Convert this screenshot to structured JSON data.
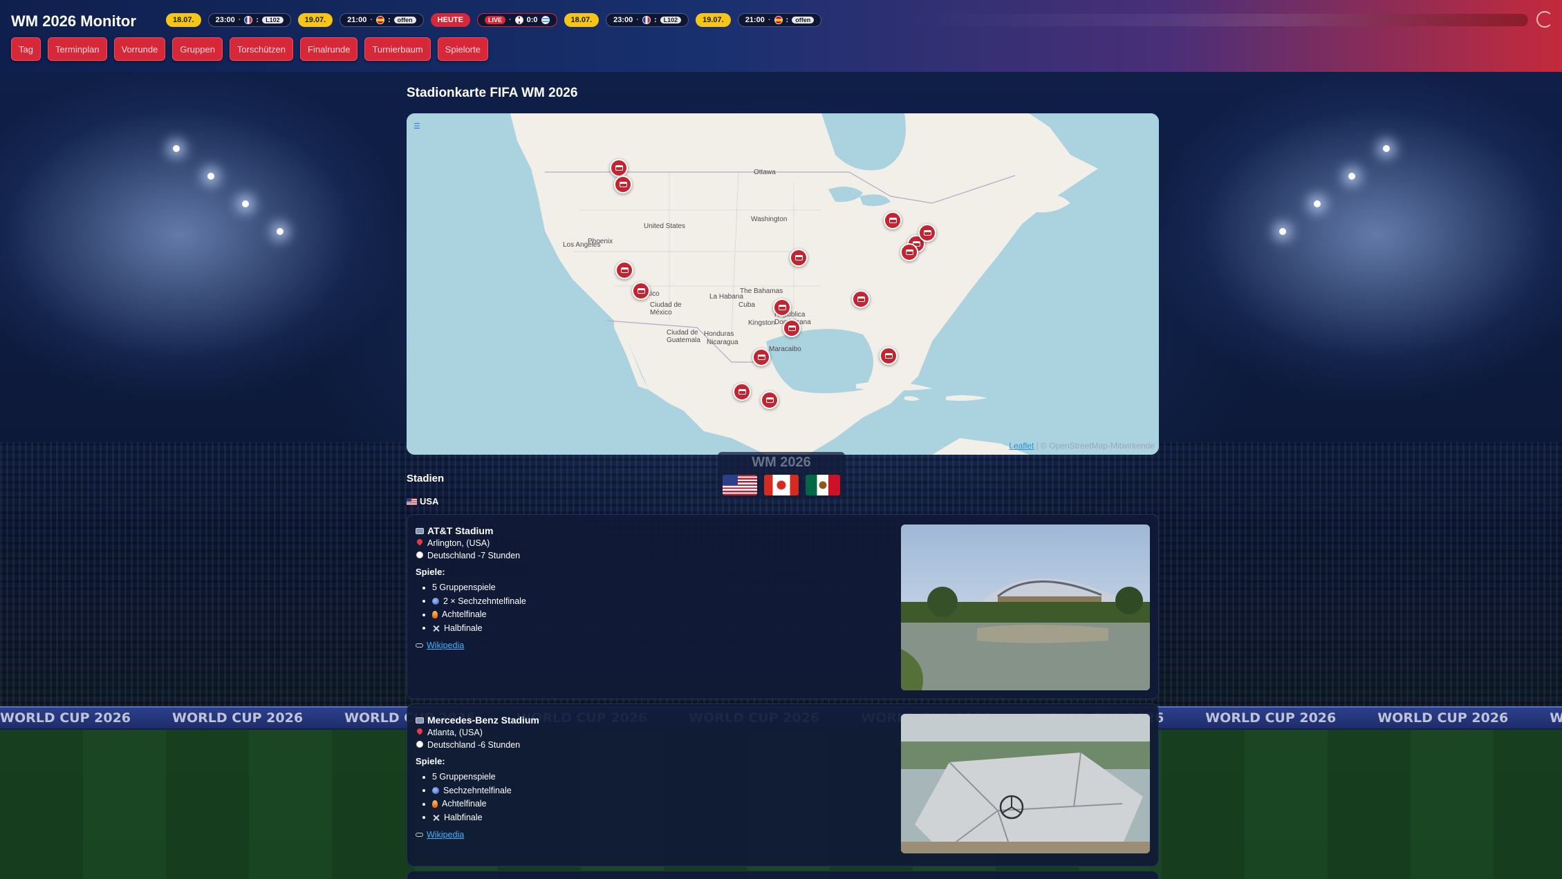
{
  "app": {
    "title": "WM 2026 Monitor"
  },
  "ticker": [
    {
      "kind": "date",
      "text": "18.07."
    },
    {
      "kind": "match",
      "time": "23:00",
      "flag": "#1f3fa0",
      "score": ":",
      "badge": "L102"
    },
    {
      "kind": "date",
      "text": "19.07."
    },
    {
      "kind": "match",
      "time": "21:00",
      "flag": "#e0a21b",
      "score": ":",
      "badge": "offen"
    },
    {
      "kind": "today",
      "text": "HEUTE"
    },
    {
      "kind": "live",
      "live": "LIVE",
      "flag": "#ffffff",
      "score": "0:0"
    },
    {
      "kind": "date",
      "text": "18.07."
    },
    {
      "kind": "match",
      "time": "23:00",
      "flag": "#1f3fa0",
      "score": ":",
      "badge": "L102"
    },
    {
      "kind": "date",
      "text": "19.07."
    },
    {
      "kind": "match",
      "time": "21:00",
      "flag": "#e0a21b",
      "score": ":",
      "badge": "offen"
    }
  ],
  "nav": [
    "Tag",
    "Terminplan",
    "Vorrunde",
    "Gruppen",
    "Torschützen",
    "Finalrunde",
    "Turnierbaum",
    "Spielorte"
  ],
  "page": {
    "title": "Stadionkarte FIFA WM 2026"
  },
  "map": {
    "labels": {
      "ottawa": "Ottawa",
      "united_states": "United States",
      "washington": "Washington",
      "phoenix": "Phoenix",
      "los_angeles": "Los Angeles",
      "mexico": "México",
      "ciudad_de_mexico": "Ciudad de México",
      "la_habana": "La Habana",
      "the_bahamas": "The Bahamas",
      "cuba": "Cuba",
      "republica_dominicana": "República Dominicana",
      "kingston": "Kingston",
      "ciudad_de_guatemala": "Ciudad de Guatemala",
      "honduras": "Honduras",
      "nicaragua": "Nicaragua",
      "maracaibo": "Maracaibo"
    },
    "attribution_link": "Leaflet",
    "attribution_text": " | © OpenStreetMap-Mitwirkende",
    "colors": {
      "water": "#aad3df",
      "land": "#f2efe9",
      "marker": "#c4232f"
    }
  },
  "watermark": {
    "text": "WM 2026"
  },
  "stadiums_heading": "Stadien",
  "country": "USA",
  "stadiums": [
    {
      "name": "AT&T Stadium",
      "location": "Arlington, (USA)",
      "timezone": "Deutschland -7 Stunden",
      "games_label": "Spiele:",
      "games": [
        {
          "icon": "none",
          "text": "5 Gruppenspiele"
        },
        {
          "icon": "ball-icon",
          "text": "2 × Sechzehntelfinale"
        },
        {
          "icon": "fire-icon",
          "text": "Achtelfinale"
        },
        {
          "icon": "swords-icon",
          "text": "Halbfinale"
        }
      ],
      "link": "Wikipedia"
    },
    {
      "name": "Mercedes-Benz Stadium",
      "location": "Atlanta, (USA)",
      "timezone": "Deutschland -6 Stunden",
      "games_label": "Spiele:",
      "games": [
        {
          "icon": "none",
          "text": "5 Gruppenspiele"
        },
        {
          "icon": "ball-icon",
          "text": "Sechzehntelfinale"
        },
        {
          "icon": "fire-icon",
          "text": "Achtelfinale"
        },
        {
          "icon": "swords-icon",
          "text": "Halbfinale"
        }
      ],
      "link": "Wikipedia"
    }
  ],
  "background": {
    "banner_text": "WORLD CUP 2026"
  }
}
